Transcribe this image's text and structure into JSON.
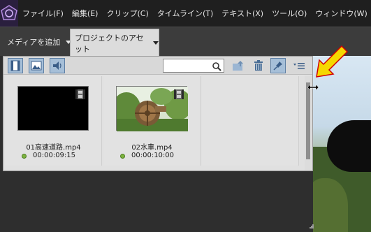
{
  "menu": {
    "items": [
      "ファイル(F)",
      "編集(E)",
      "クリップ(C)",
      "タイムライン(T)",
      "テキスト(X)",
      "ツール(O)",
      "ウィンドウ(W)"
    ]
  },
  "subbar": {
    "add_media_label": "メディアを追加",
    "project_assets_label": "プロジェクトのアセット"
  },
  "assets_panel": {
    "search_placeholder": "",
    "items": [
      {
        "name": "01高速道路.mp4",
        "duration": "00:00:09:15"
      },
      {
        "name": "02水車.mp4",
        "duration": "00:00:10:00"
      }
    ]
  },
  "colors": {
    "annotation_arrow": "#f5d800",
    "status_dot": "#7db33f",
    "active_button": "#a6bfd8"
  },
  "icons": [
    "app-logo-icon",
    "video-filter-icon",
    "image-filter-icon",
    "audio-filter-icon",
    "search-icon",
    "folder-up-icon",
    "trash-icon",
    "pin-icon",
    "panel-menu-icon",
    "film-strip-icon",
    "resize-cursor-icon",
    "resize-grip-icon"
  ]
}
